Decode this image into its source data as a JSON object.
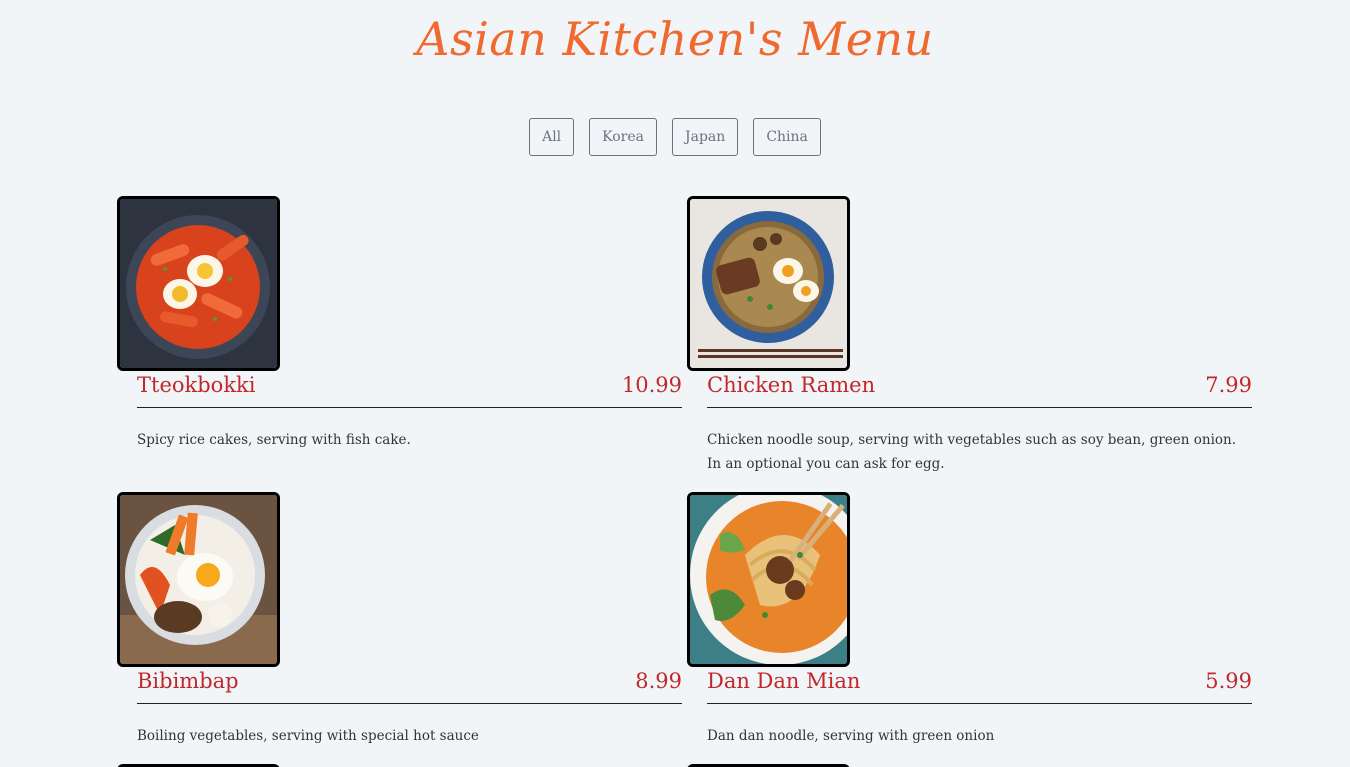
{
  "header": {
    "title": "Asian Kitchen's Menu"
  },
  "filters": [
    {
      "label": "All"
    },
    {
      "label": "Korea"
    },
    {
      "label": "Japan"
    },
    {
      "label": "China"
    }
  ],
  "colors": {
    "title": "#f0692e",
    "accent": "#c0282b",
    "background": "#f1f5f8"
  },
  "menu": [
    {
      "name": "Tteokbokki",
      "price": "10.99",
      "desc": "Spicy rice cakes, serving with fish cake."
    },
    {
      "name": "Chicken Ramen",
      "price": "7.99",
      "desc": "Chicken noodle soup, serving with vegetables such as soy bean, green onion. In an optional you can ask for egg."
    },
    {
      "name": "Bibimbap",
      "price": "8.99",
      "desc": "Boiling vegetables, serving with special hot sauce"
    },
    {
      "name": "Dan Dan Mian",
      "price": "5.99",
      "desc": "Dan dan noodle, serving with green onion"
    }
  ]
}
